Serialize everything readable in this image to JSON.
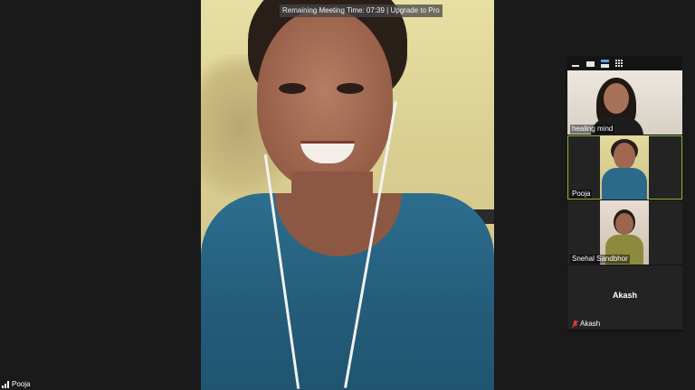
{
  "meeting": {
    "banner_text": "Remaining Meeting Time: 07:39 | Upgrade to Pro",
    "active_speaker": "Pooja"
  },
  "gallery": {
    "toolbar_icons": [
      "minimize-icon",
      "thumbnail-view-icon",
      "speaker-view-icon",
      "gallery-view-icon"
    ],
    "participants": [
      {
        "name": "healing mind",
        "video": true,
        "active": false
      },
      {
        "name": "Pooja",
        "video": true,
        "active": true
      },
      {
        "name": "Snehal Sandbhor",
        "video": true,
        "active": false
      },
      {
        "name": "Akash",
        "display_name": "Akash",
        "video": false,
        "muted": true,
        "active": false
      }
    ]
  },
  "colors": {
    "active_border": "#86b83a",
    "muted_icon": "#e03c3c",
    "background": "#1a1a1a"
  }
}
